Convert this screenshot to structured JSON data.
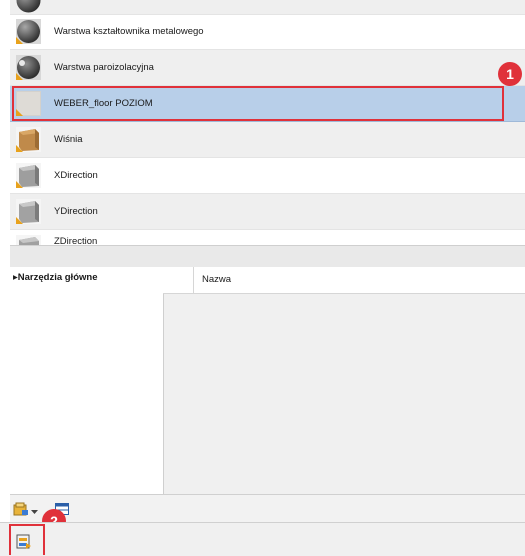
{
  "materials": {
    "items": [
      {
        "label": "Warstwa kształtownika metalowego",
        "thumb": "dark-sphere",
        "selected": false
      },
      {
        "label": "Warstwa paroizolacyjna",
        "thumb": "dark-sphere",
        "selected": false
      },
      {
        "label": "WEBER_floor POZIOM",
        "thumb": "light-plane",
        "selected": true
      },
      {
        "label": "Wiśnia",
        "thumb": "wood-cube",
        "selected": false
      },
      {
        "label": "XDirection",
        "thumb": "gray-cube",
        "selected": false
      },
      {
        "label": "YDirection",
        "thumb": "gray-cube",
        "selected": false
      },
      {
        "label": "ZDirection",
        "thumb": "gray-cube",
        "selected": false
      }
    ]
  },
  "annotations": {
    "marker1": "1",
    "marker2": "2",
    "color": "#e0313a"
  },
  "properties": {
    "group_label": "▸Narzędzia główne",
    "column_label": "Nazwa"
  },
  "toolbar": {
    "icons": [
      "new-material-icon",
      "dropdown-arrow-icon",
      "panel-toggle-icon"
    ]
  },
  "bottom": {
    "icons": [
      "material-browser-icon"
    ]
  },
  "colors": {
    "selected_row": "#b8cfe9",
    "alt_row": "#efefef",
    "highlight": "#e0313a"
  }
}
